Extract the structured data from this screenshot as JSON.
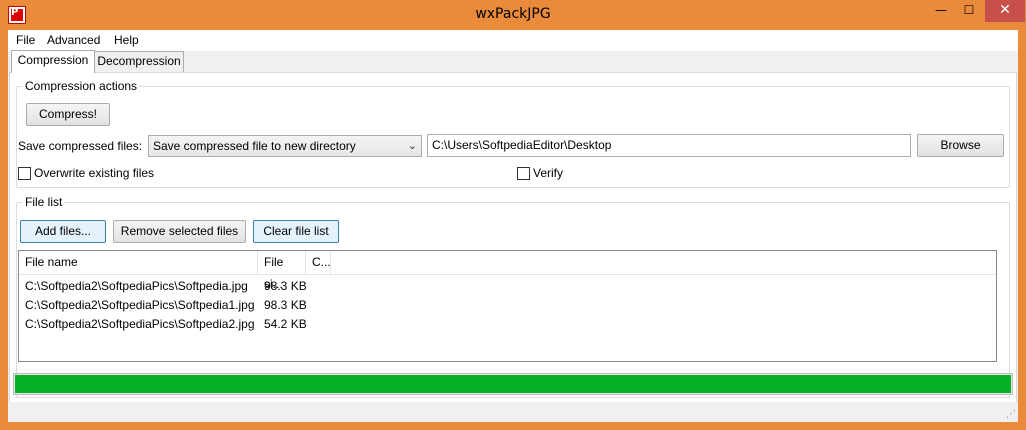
{
  "window": {
    "title": "wxPackJPG",
    "icon": "packjpg-app-icon",
    "icon_letter": "P",
    "controls": {
      "minimize": "—",
      "maximize": "☐",
      "close": "✕"
    },
    "accent": "#ea8b3b"
  },
  "menu": {
    "items": [
      "File",
      "Advanced",
      "Help"
    ]
  },
  "tabs": [
    {
      "label": "Compression",
      "active": true
    },
    {
      "label": "Decompression",
      "active": false
    }
  ],
  "compression_actions": {
    "title": "Compression actions",
    "compress_label": "Compress!",
    "save_label": "Save compressed files:",
    "save_mode": "Save compressed file to new directory",
    "directory": "C:\\Users\\SoftpediaEditor\\Desktop",
    "browse_label": "Browse",
    "overwrite_label": "Overwrite existing files",
    "overwrite_checked": false,
    "verify_label": "Verify",
    "verify_checked": false
  },
  "file_list": {
    "title": "File list",
    "add_label": "Add files...",
    "remove_label": "Remove selected files",
    "clear_label": "Clear file list",
    "columns": [
      "File name",
      "File si...",
      "C..."
    ],
    "rows": [
      {
        "name": "C:\\Softpedia2\\SoftpediaPics\\Softpedia.jpg",
        "size": "98.3 KB",
        "c": ""
      },
      {
        "name": "C:\\Softpedia2\\SoftpediaPics\\Softpedia1.jpg",
        "size": "98.3 KB",
        "c": ""
      },
      {
        "name": "C:\\Softpedia2\\SoftpediaPics\\Softpedia2.jpg",
        "size": "54.2 KB",
        "c": ""
      }
    ]
  },
  "progress": {
    "value": 1.0,
    "color": "#06b025"
  },
  "status": {
    "grip_icon": "resize-grip-icon"
  }
}
